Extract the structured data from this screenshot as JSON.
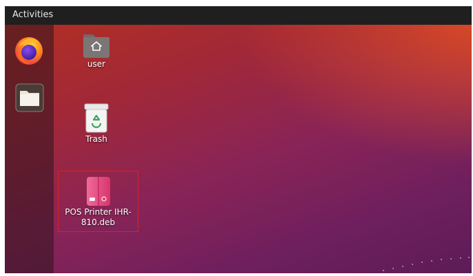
{
  "topbar": {
    "activities_label": "Activities"
  },
  "dock": {
    "items": [
      {
        "name": "firefox",
        "icon": "firefox-icon"
      },
      {
        "name": "files",
        "icon": "folder-icon"
      }
    ]
  },
  "desktop": {
    "items": [
      {
        "label": "user",
        "icon": "home-folder-icon"
      },
      {
        "label": "Trash",
        "icon": "trash-icon"
      },
      {
        "label_line1": "POS Printer IHR-",
        "label_line2": "810.deb",
        "icon": "deb-package-icon",
        "selected": true
      }
    ]
  },
  "colors": {
    "topbar": "#1f1f1f",
    "selection_border": "#e02020",
    "package_pink": "#e8457a"
  }
}
